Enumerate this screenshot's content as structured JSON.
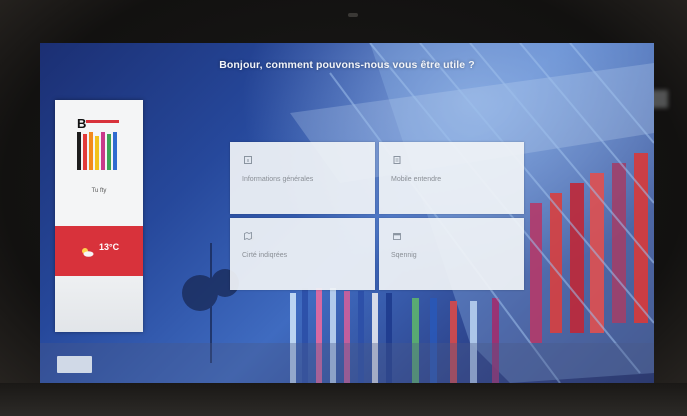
{
  "screen": {
    "greeting": "Bonjour, comment pouvons-nous vous être utile ?"
  },
  "sidebar": {
    "logo_letter": "B",
    "city": "Tu fty",
    "city_sub": "",
    "weather": {
      "day": "",
      "temperature": "13°C",
      "description": ""
    }
  },
  "tiles": [
    {
      "label": "Informations générales",
      "icon": "info-icon"
    },
    {
      "label": "Mobile entendre",
      "icon": "document-icon"
    },
    {
      "label": "Cirté indiqrées",
      "icon": "map-icon"
    },
    {
      "label": "Sqennig",
      "icon": "calendar-icon"
    }
  ],
  "footer": {
    "note": ""
  },
  "colors": {
    "weather_band": "#d8323b",
    "tile_bg": "#f0f3f6",
    "screen_blue": "#26489b"
  }
}
